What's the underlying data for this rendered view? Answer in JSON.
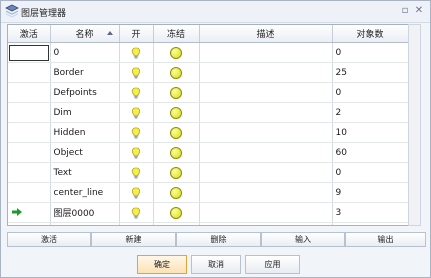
{
  "window": {
    "title": "图层管理器"
  },
  "titlebar": {
    "restore_glyph": "▫",
    "close_glyph": "✕"
  },
  "columns": [
    "激活",
    "名称",
    "开",
    "冻结",
    "描述",
    "对象数"
  ],
  "layers": [
    {
      "name": "0",
      "count": "0",
      "current": false
    },
    {
      "name": "Border",
      "count": "25",
      "current": false
    },
    {
      "name": "Defpoints",
      "count": "0",
      "current": false
    },
    {
      "name": "Dim",
      "count": "2",
      "current": false
    },
    {
      "name": "Hidden",
      "count": "10",
      "current": false
    },
    {
      "name": "Object",
      "count": "60",
      "current": false
    },
    {
      "name": "Text",
      "count": "0",
      "current": false
    },
    {
      "name": "center_line",
      "count": "9",
      "current": false
    },
    {
      "name": "图层0000",
      "count": "3",
      "current": true
    }
  ],
  "actions": {
    "activate": "激活",
    "new": "新建",
    "delete": "删除",
    "import": "输入",
    "export": "输出"
  },
  "footer": {
    "ok": "确定",
    "cancel": "取消",
    "apply": "应用"
  },
  "icons": {
    "on": "lightbulb-icon",
    "freeze": "sun-icon",
    "current": "green-arrow-icon"
  },
  "colors": {
    "arrow": "#1f9a2a",
    "primary_border": "#e1a63a"
  }
}
